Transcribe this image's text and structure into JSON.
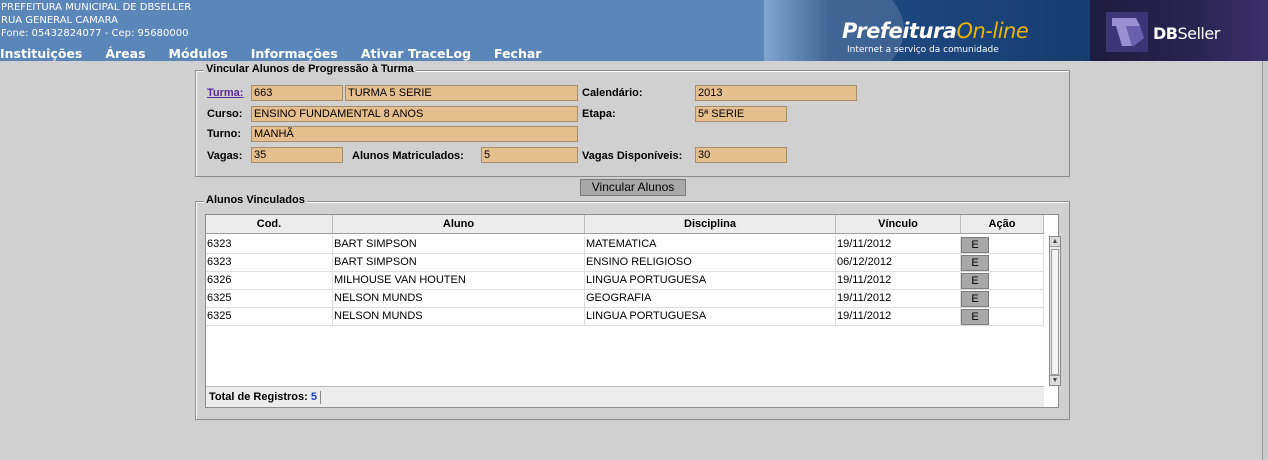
{
  "header": {
    "inst_line1": "PREFEITURA MUNICIPAL DE DBSELLER",
    "inst_line2": "RUA GENERAL CAMARA",
    "inst_line3": "Fone: 05432824077  -  Cep: 95680000",
    "menu": [
      "Instituições",
      "Áreas",
      "Módulos",
      "Informações",
      "Ativar TraceLog",
      "Fechar"
    ],
    "banner_brand": "Prefeitura",
    "banner_brand_ol": "On-line",
    "banner_tag": "Internet a serviço da comunidade",
    "dbseller_bold": "DB",
    "dbseller_rest": "Seller"
  },
  "form": {
    "legend": "Vincular Alunos de Progressão à Turma",
    "turma_label": "Turma:",
    "turma_code": "663",
    "turma_name": "TURMA 5 SERIE",
    "calendario_label": "Calendário:",
    "calendario": "2013",
    "curso_label": "Curso:",
    "curso": "ENSINO FUNDAMENTAL 8 ANOS",
    "etapa_label": "Etapa:",
    "etapa": "5ª SERIE",
    "turno_label": "Turno:",
    "turno": "MANHÃ",
    "vagas_label": "Vagas:",
    "vagas": "35",
    "matriculados_label": "Alunos Matriculados:",
    "matriculados": "5",
    "disponiveis_label": "Vagas Disponíveis:",
    "disponiveis": "30",
    "vincular_button": "Vincular Alunos"
  },
  "grid": {
    "legend": "Alunos Vinculados",
    "columns": [
      "Cod.",
      "Aluno",
      "Disciplina",
      "Vínculo",
      "Ação"
    ],
    "rows": [
      {
        "cod": "6323",
        "aluno": "BART SIMPSON",
        "disciplina": "MATEMATICA",
        "vinculo": "19/11/2012",
        "acao": "E"
      },
      {
        "cod": "6323",
        "aluno": "BART SIMPSON",
        "disciplina": "ENSINO RELIGIOSO",
        "vinculo": "06/12/2012",
        "acao": "E"
      },
      {
        "cod": "6326",
        "aluno": "MILHOUSE VAN HOUTEN",
        "disciplina": "LINGUA PORTUGUESA",
        "vinculo": "19/11/2012",
        "acao": "E"
      },
      {
        "cod": "6325",
        "aluno": "NELSON MUNDS",
        "disciplina": "GEOGRAFIA",
        "vinculo": "19/11/2012",
        "acao": "E"
      },
      {
        "cod": "6325",
        "aluno": "NELSON MUNDS",
        "disciplina": "LINGUA PORTUGUESA",
        "vinculo": "19/11/2012",
        "acao": "E"
      }
    ],
    "total_label": "Total de Registros:",
    "total": "5"
  }
}
